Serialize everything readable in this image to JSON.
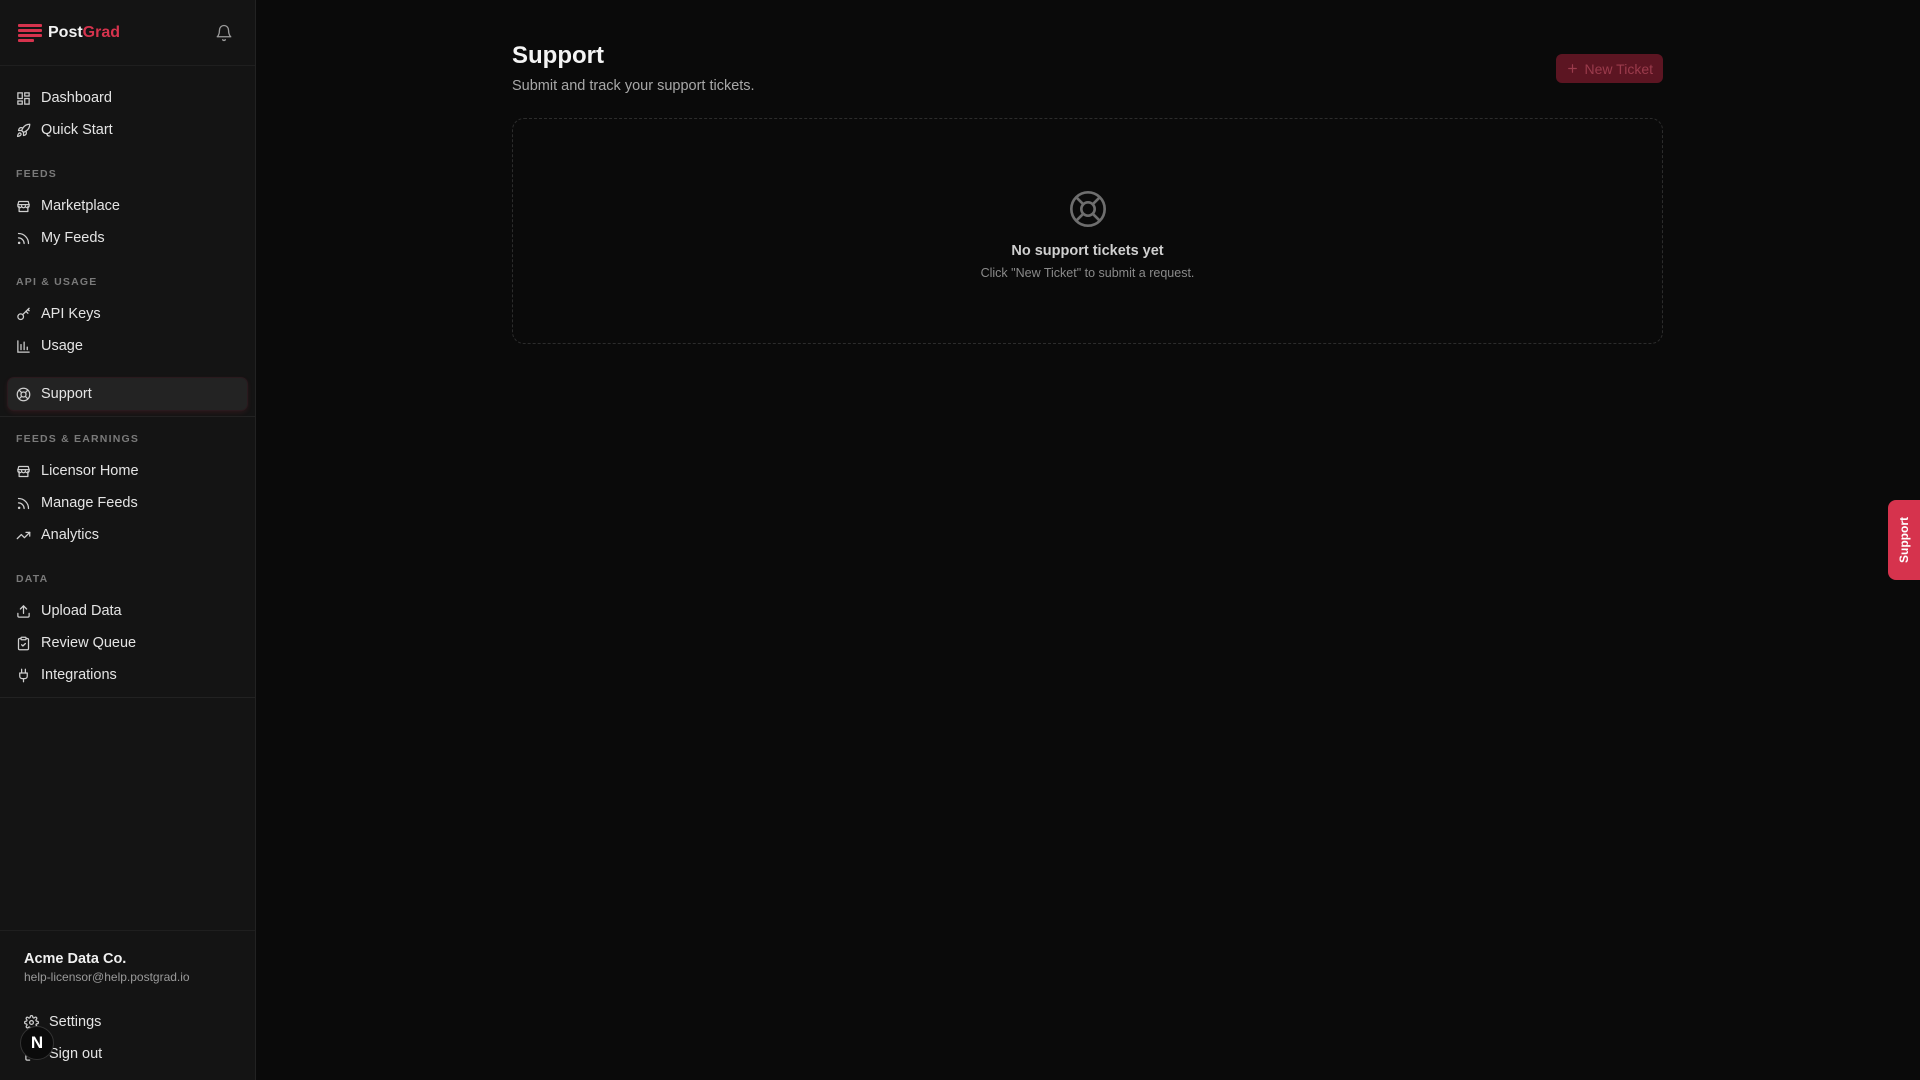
{
  "brand": {
    "part1": "Post",
    "part2": "Grad",
    "accent": "#d6334d"
  },
  "sidebar": {
    "top": [
      {
        "label": "Dashboard",
        "icon": "dashboard-icon"
      },
      {
        "label": "Quick Start",
        "icon": "rocket-icon"
      }
    ],
    "sections": [
      {
        "label": "FEEDS",
        "items": [
          {
            "label": "Marketplace",
            "icon": "store-icon"
          },
          {
            "label": "My Feeds",
            "icon": "rss-icon"
          }
        ]
      },
      {
        "label": "API & USAGE",
        "items": [
          {
            "label": "API Keys",
            "icon": "key-icon"
          },
          {
            "label": "Usage",
            "icon": "bar-chart-icon"
          }
        ]
      }
    ],
    "active": {
      "label": "Support",
      "icon": "lifebuoy-icon"
    },
    "sections2": [
      {
        "label": "FEEDS & EARNINGS",
        "items": [
          {
            "label": "Licensor Home",
            "icon": "store-icon"
          },
          {
            "label": "Manage Feeds",
            "icon": "rss-icon"
          },
          {
            "label": "Analytics",
            "icon": "trending-up-icon"
          }
        ]
      },
      {
        "label": "DATA",
        "items": [
          {
            "label": "Upload Data",
            "icon": "upload-icon"
          },
          {
            "label": "Review Queue",
            "icon": "clipboard-check-icon"
          },
          {
            "label": "Integrations",
            "icon": "plug-icon"
          }
        ]
      }
    ],
    "footer": {
      "org_name": "Acme Data Co.",
      "email": "help-licensor@help.postgrad.io",
      "settings_label": "Settings",
      "signout_label": "Sign out",
      "avatar_letter": "N"
    }
  },
  "main": {
    "title": "Support",
    "subtitle": "Submit and track your support tickets.",
    "new_ticket_label": "New Ticket",
    "empty_title": "No support tickets yet",
    "empty_subtitle": "Click \"New Ticket\" to submit a request."
  },
  "support_tab_label": "Support"
}
